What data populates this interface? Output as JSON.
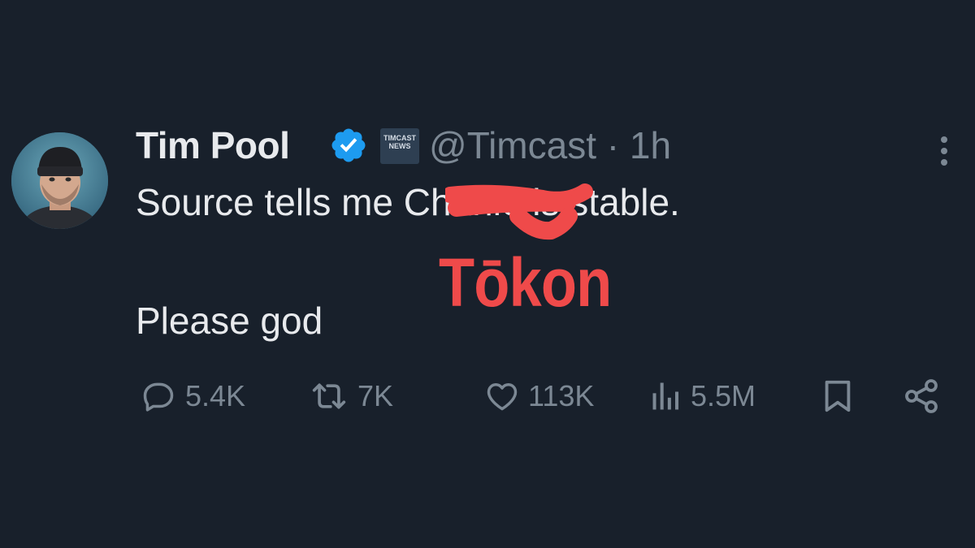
{
  "tweet": {
    "author_name": "Tim Pool",
    "affiliate_badge_text": "TIMCAST\nNEWS",
    "handle": "@Timcast",
    "separator": "·",
    "timestamp": "1h",
    "line1_before": "Source tells me ",
    "line1_hidden": "Charlie",
    "line1_after": " is stable.",
    "line2": "Please god",
    "overlay_text": "Tōkon",
    "overlay_color": "#ef4a4a"
  },
  "actions": {
    "replies": "5.4K",
    "reposts": "7K",
    "likes": "113K",
    "views": "5.5M"
  },
  "icons": {
    "verified": "verified-badge-icon",
    "more": "more-vertical-icon",
    "reply": "reply-icon",
    "repost": "repost-icon",
    "like": "heart-icon",
    "views": "views-icon",
    "bookmark": "bookmark-icon",
    "share": "share-icon"
  },
  "colors": {
    "background": "#18202b",
    "text": "#e8eaed",
    "muted": "#7c8894",
    "verified": "#1d9bf0"
  }
}
